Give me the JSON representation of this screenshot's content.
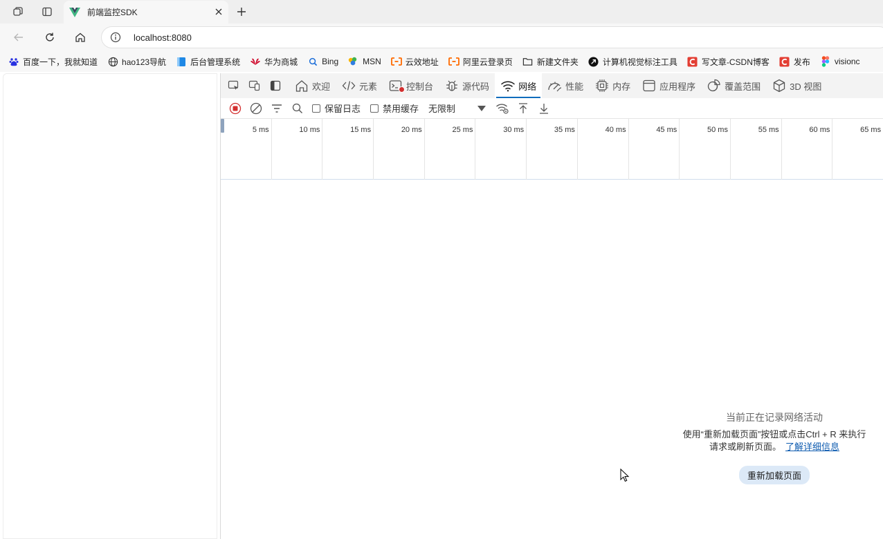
{
  "browser": {
    "tab_title": "前端监控SDK",
    "url": "localhost:8080",
    "bookmarks": [
      {
        "label": "百度一下，我就知道",
        "icon": "baidu-icon",
        "color": "#2932e1"
      },
      {
        "label": "hao123导航",
        "icon": "globe-icon",
        "color": "#333333"
      },
      {
        "label": "后台管理系统",
        "icon": "folder-blue-icon",
        "color": "#1e88e5"
      },
      {
        "label": "华为商城",
        "icon": "huawei-icon",
        "color": "#cf0a2c"
      },
      {
        "label": "Bing",
        "icon": "search-icon",
        "color": "#1e6fd9"
      },
      {
        "label": "MSN",
        "icon": "msn-icon",
        "color": "#2f7de1"
      },
      {
        "label": "云效地址",
        "icon": "aliyun-icon",
        "color": "#ff6a00"
      },
      {
        "label": "阿里云登录页",
        "icon": "aliyun-icon",
        "color": "#ff6a00"
      },
      {
        "label": "新建文件夹",
        "icon": "folder-icon",
        "color": "#333333"
      },
      {
        "label": "计算机视觉标注工具",
        "icon": "arrow-circle-icon",
        "color": "#111111"
      },
      {
        "label": "写文章-CSDN博客",
        "icon": "csdn-icon",
        "color": "#e33e33"
      },
      {
        "label": "发布",
        "icon": "csdn-icon",
        "color": "#e33e33"
      },
      {
        "label": "visionc",
        "icon": "figma-icon",
        "color": "#a259ff"
      }
    ]
  },
  "devtools": {
    "tabs": [
      {
        "label": "欢迎",
        "icon": "home-icon",
        "active": false
      },
      {
        "label": "元素",
        "icon": "code-icon",
        "active": false
      },
      {
        "label": "控制台",
        "icon": "console-icon",
        "active": false,
        "error": true
      },
      {
        "label": "源代码",
        "icon": "bug-icon",
        "active": false
      },
      {
        "label": "网络",
        "icon": "wifi-icon",
        "active": true
      },
      {
        "label": "性能",
        "icon": "performance-icon",
        "active": false
      },
      {
        "label": "内存",
        "icon": "memory-icon",
        "active": false
      },
      {
        "label": "应用程序",
        "icon": "application-icon",
        "active": false
      },
      {
        "label": "覆盖范围",
        "icon": "coverage-icon",
        "active": false
      },
      {
        "label": "3D 视图",
        "icon": "cube-icon",
        "active": false
      }
    ],
    "toolbar": {
      "preserve_log": "保留日志",
      "disable_cache": "禁用缓存",
      "throttling": "无限制"
    },
    "timeline_ticks": [
      "5 ms",
      "10 ms",
      "15 ms",
      "20 ms",
      "25 ms",
      "30 ms",
      "35 ms",
      "40 ms",
      "45 ms",
      "50 ms",
      "55 ms",
      "60 ms",
      "65 ms"
    ],
    "empty_state": {
      "title": "当前正在记录网络活动",
      "desc_line1": "使用“重新加载页面”按钮或点击Ctrl + R 来执行",
      "desc_line2": "请求或刷新页面。",
      "learn_more": "了解详细信息",
      "reload_button": "重新加载页面"
    },
    "accent_color": "#0f6cbd",
    "record_color": "#d32f2f"
  }
}
